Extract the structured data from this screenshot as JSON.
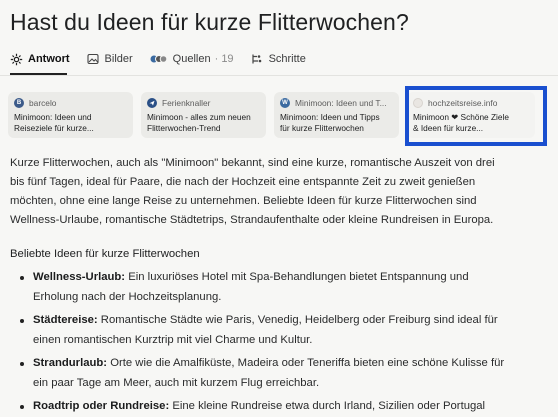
{
  "title": "Hast du Ideen für kurze Flitterwochen?",
  "tabs": [
    {
      "label": "Antwort",
      "icon": "answer-icon",
      "active": true
    },
    {
      "label": "Bilder",
      "icon": "image-icon"
    },
    {
      "label": "Quellen",
      "icon": "sources-icon",
      "count": "· 19"
    },
    {
      "label": "Schritte",
      "icon": "steps-icon"
    }
  ],
  "sources": [
    {
      "site": "barcelo",
      "desc": "Minimoon: Ideen und\nReiseziele für kurze...",
      "fav_color": "#3c5b8a",
      "fav_letter": "B"
    },
    {
      "site": "Ferienknaller",
      "desc": "Minimoon - alles zum neuen\nFlitterwochen-Trend",
      "fav_color": "#2a4f86",
      "fav_letter": "F"
    },
    {
      "site": "Minimoon: Ideen und T...",
      "desc": "Minimoon: Ideen und Tipps\nfür kurze Flitterwochen",
      "fav_color": "#3b6aa0",
      "fav_letter": "W"
    },
    {
      "site": "hochzeitsreise.info",
      "desc": "Minimoon ❤ Schöne Ziele\n& Ideen für kurze...",
      "fav_color": "#e9e6e2",
      "fav_letter": ""
    }
  ],
  "intro": "Kurze Flitterwochen, auch als \"Minimoon\" bekannt, sind eine kurze, romantische Auszeit von drei\nbis fünf Tagen, ideal für Paare, die nach der Hochzeit eine entspannte Zeit zu zweit genießen\nmöchten, ohne eine lange Reise zu unternehmen. Beliebte Ideen für kurze Flitterwochen sind\nWellness-Urlaube, romantische Städtetrips, Strandaufenthalte oder kleine Rundreisen in Europa.",
  "section_title": "Beliebte Ideen für kurze Flitterwochen",
  "ideas": [
    {
      "term": "Wellness-Urlaub:",
      "text": " Ein luxuriöses Hotel mit Spa-Behandlungen bietet Entspannung und\nErholung nach der Hochzeitsplanung."
    },
    {
      "term": "Städtereise:",
      "text": " Romantische Städte wie Paris, Venedig, Heidelberg oder Freiburg sind ideal für\neinen romantischen Kurztrip mit viel Charme und Kultur."
    },
    {
      "term": "Strandurlaub:",
      "text": " Orte wie die Amalfiküste, Madeira oder Teneriffa bieten eine schöne Kulisse für\nein paar Tage am Meer, auch mit kurzem Flug erreichbar."
    },
    {
      "term": "Roadtrip oder Rundreise:",
      "text": " Eine kleine Rundreise etwa durch Irland, Sizilien oder Portugal"
    }
  ],
  "colors": {
    "highlight": "#1a4fcf",
    "background": "#f7f7f5",
    "card": "#ebebe8"
  }
}
